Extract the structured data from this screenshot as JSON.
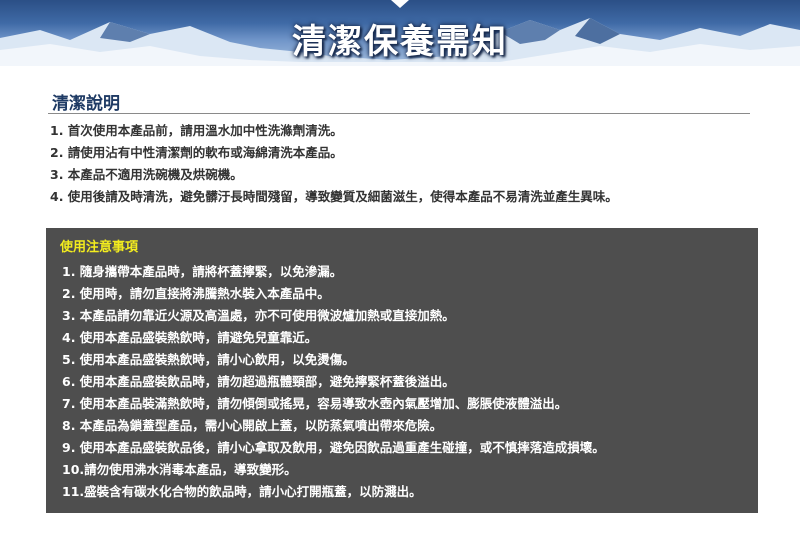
{
  "banner": {
    "title": "清潔保養需知"
  },
  "cleaning": {
    "title": "清潔說明",
    "items": [
      "1. 首次使用本產品前，請用溫水加中性洗滌劑清洗。",
      "2. 請使用沾有中性清潔劑的軟布或海綿清洗本產品。",
      "3. 本產品不適用洗碗機及烘碗機。",
      "4. 使用後請及時清洗，避免髒汙長時間殘留，導致變質及細菌滋生，使得本產品不易清洗並產生異味。"
    ]
  },
  "caution": {
    "title": "使用注意事項",
    "items": [
      "1. 隨身攜帶本產品時，請將杯蓋擰緊，以免滲漏。",
      "2. 使用時，請勿直接將沸騰熱水裝入本產品中。",
      "3. 本產品請勿靠近火源及高溫處，亦不可使用微波爐加熱或直接加熱。",
      "4. 使用本產品盛裝熱飲時，請避免兒童靠近。",
      "5. 使用本產品盛裝熱飲時，請小心飲用，以免燙傷。",
      "6. 使用本產品盛裝飲品時，請勿超過瓶體頸部，避免擰緊杯蓋後溢出。",
      "7. 使用本產品裝滿熱飲時，請勿傾倒或搖晃，容易導致水壺內氣壓增加、膨脹使液體溢出。",
      "8. 本產品為鎖蓋型產品，需小心開啟上蓋，以防蒸氣噴出帶來危險。",
      "9. 使用本產品盛裝飲品後，請小心拿取及飲用，避免因飲品過重產生碰撞，或不慎摔落造成損壞。",
      "10.請勿使用沸水消毒本產品，導致變形。",
      "11.盛裝含有碳水化合物的飲品時，請小心打開瓶蓋，以防濺出。"
    ]
  },
  "colors": {
    "heading": "#1e3a64",
    "caution_bg": "#4e4e4e",
    "caution_title": "#f3ec1e"
  }
}
